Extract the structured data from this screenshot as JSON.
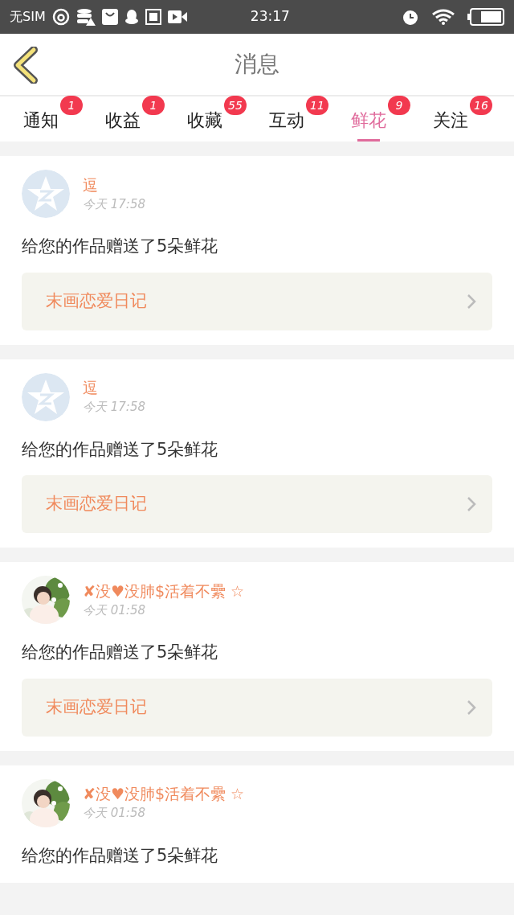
{
  "status_bar": {
    "carrier": "无SIM",
    "time": "23:17"
  },
  "header": {
    "title": "消息"
  },
  "tabs": [
    {
      "label": "通知",
      "badge": "1",
      "selected": false
    },
    {
      "label": "收益",
      "badge": "1",
      "selected": false
    },
    {
      "label": "收藏",
      "badge": "55",
      "selected": false
    },
    {
      "label": "互动",
      "badge": "11",
      "selected": false
    },
    {
      "label": "鲜花",
      "badge": "9",
      "selected": true
    },
    {
      "label": "关注",
      "badge": "16",
      "selected": false
    }
  ],
  "messages": [
    {
      "avatar": {
        "kind": "default"
      },
      "name": "逗",
      "time": "今天  17:58",
      "text": "给您的作品赠送了5朵鲜花",
      "post": {
        "title": "末画恋爱日记"
      }
    },
    {
      "avatar": {
        "kind": "default"
      },
      "name": "逗",
      "time": "今天  17:58",
      "text": "给您的作品赠送了5朵鲜花",
      "post": {
        "title": "末画恋爱日记"
      }
    },
    {
      "name": "✘没♥没肺$活着不纍 ☆",
      "time": "今天  01:58",
      "text": "给您的作品赠送了5朵鲜花",
      "post": {
        "title": "末画恋爱日记"
      }
    },
    {
      "name": "✘没♥没肺$活着不纍 ☆",
      "time": "今天  01:58",
      "text": "给您的作品赠送了5朵鲜花"
    }
  ]
}
